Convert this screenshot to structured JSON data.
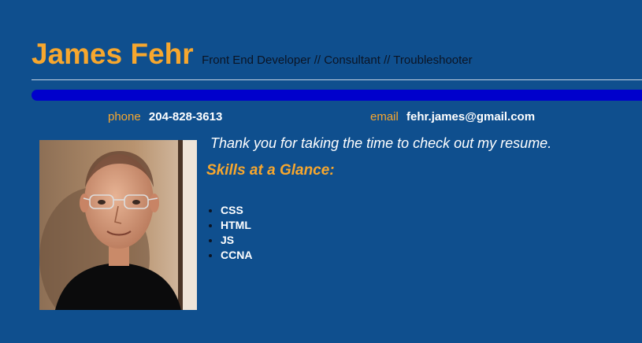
{
  "header": {
    "name": "James Fehr",
    "tagline": "Front End Developer // Consultant // Troubleshooter"
  },
  "contact": {
    "phone_label": "phone",
    "phone": "204-828-3613",
    "email_label": "email",
    "email": "fehr.james@gmail.com"
  },
  "main": {
    "intro": "Thank you for taking the time to check out my resume.",
    "skills_title": "Skills at a Glance:",
    "skills": [
      "CSS",
      "HTML",
      "JS",
      "CCNA"
    ]
  },
  "colors": {
    "background": "#0f4f8e",
    "accent": "#f7a72e",
    "bar": "#0000cc"
  }
}
